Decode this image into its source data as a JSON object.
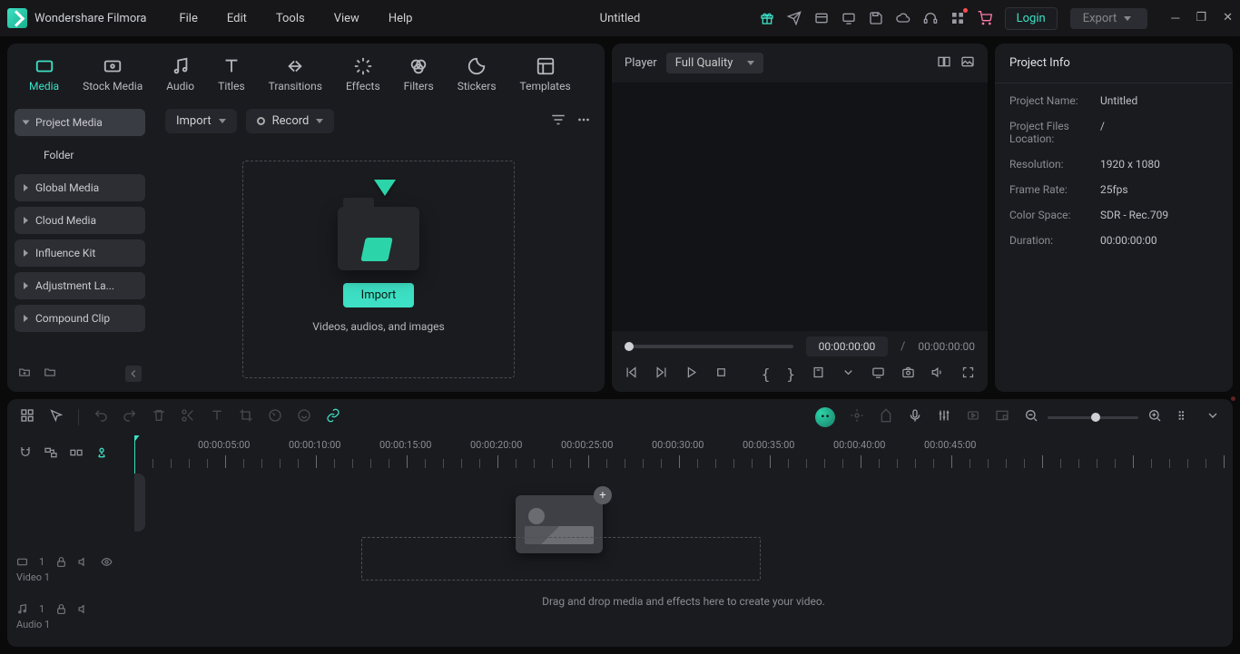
{
  "app": {
    "name": "Wondershare Filmora",
    "document": "Untitled"
  },
  "menu": [
    "File",
    "Edit",
    "Tools",
    "View",
    "Help"
  ],
  "titlebar": {
    "login": "Login",
    "export": "Export"
  },
  "library_tabs": [
    {
      "id": "media",
      "label": "Media"
    },
    {
      "id": "stock",
      "label": "Stock Media"
    },
    {
      "id": "audio",
      "label": "Audio"
    },
    {
      "id": "titles",
      "label": "Titles"
    },
    {
      "id": "transitions",
      "label": "Transitions"
    },
    {
      "id": "effects",
      "label": "Effects"
    },
    {
      "id": "filters",
      "label": "Filters"
    },
    {
      "id": "stickers",
      "label": "Stickers"
    },
    {
      "id": "templates",
      "label": "Templates"
    }
  ],
  "media_tree": {
    "project": "Project Media",
    "folder": "Folder",
    "global": "Global Media",
    "cloud": "Cloud Media",
    "influence": "Influence Kit",
    "adjustment": "Adjustment La...",
    "compound": "Compound Clip"
  },
  "asset_toolbar": {
    "import": "Import",
    "record": "Record"
  },
  "dropzone": {
    "button": "Import",
    "caption": "Videos, audios, and images"
  },
  "player": {
    "label": "Player",
    "quality": "Full Quality",
    "current": "00:00:00:00",
    "total": "00:00:00:00"
  },
  "info": {
    "title": "Project Info",
    "rows": {
      "name_k": "Project Name:",
      "name_v": "Untitled",
      "loc_k": "Project Files Location:",
      "loc_v": "/",
      "res_k": "Resolution:",
      "res_v": "1920 x 1080",
      "fps_k": "Frame Rate:",
      "fps_v": "25fps",
      "cs_k": "Color Space:",
      "cs_v": "SDR - Rec.709",
      "dur_k": "Duration:",
      "dur_v": "00:00:00:00"
    }
  },
  "timeline": {
    "ruler": [
      "",
      "00:00:05:00",
      "00:00:10:00",
      "00:00:15:00",
      "00:00:20:00",
      "00:00:25:00",
      "00:00:30:00",
      "00:00:35:00",
      "00:00:40:00",
      "00:00:45:00"
    ],
    "drop_caption": "Drag and drop media and effects here to create your video.",
    "tracks": {
      "video_num": "1",
      "video": "Video 1",
      "audio_num": "1",
      "audio": "Audio 1"
    }
  }
}
